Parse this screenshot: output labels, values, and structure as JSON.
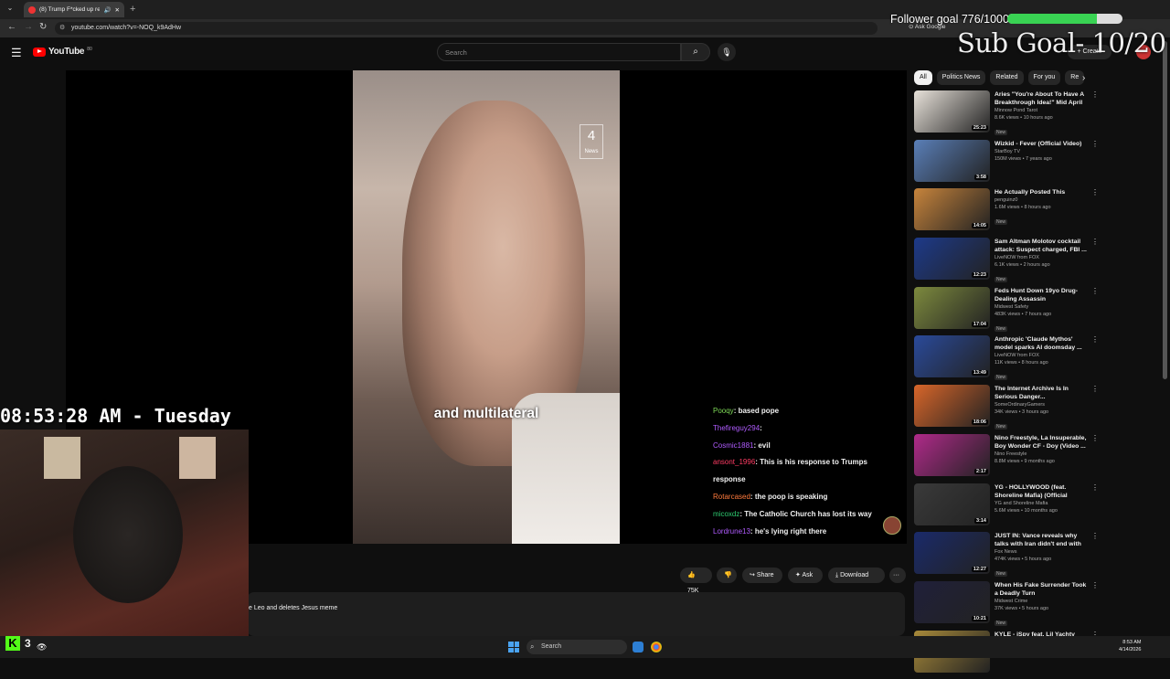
{
  "browser": {
    "tab_title": "(8) Trump F*cked up real ba...",
    "new_tab": "+",
    "url": "youtube.com/watch?v=-NOQ_k9AdHw",
    "ask_google": "Ask Google"
  },
  "yt": {
    "logo": "YouTube",
    "logo_sup": "80",
    "search_placeholder": "Search",
    "create": "+ Create",
    "chips": [
      "All",
      "Politics News",
      "Related",
      "For you",
      "Re"
    ]
  },
  "video": {
    "caption": "and multilateral",
    "channel_logo": "4",
    "channel_logo_sub": "News",
    "likes": "75K",
    "share": "Share",
    "ask": "Ask",
    "download": "Download",
    "more": "···",
    "description_snippet": "e Leo and deletes Jesus meme"
  },
  "chat": [
    {
      "user": "Pooqy",
      "color": "#7ed957",
      "msg": "based pope"
    },
    {
      "user": "Thefireguy294",
      "color": "#b05cff",
      "msg": ""
    },
    {
      "user": "Cosmic1881",
      "color": "#b05cff",
      "msg": "evil"
    },
    {
      "user": "ansont_1996",
      "color": "#ff3c64",
      "msg": "This is his response to Trumps response"
    },
    {
      "user": "Rotarcased",
      "color": "#ff7a3c",
      "msg": "the poop is speaking"
    },
    {
      "user": "micoxdz",
      "color": "#2ecc71",
      "msg": "The Catholic Church has lost its way"
    },
    {
      "user": "Lordrune13",
      "color": "#b05cff",
      "msg": "he's lying right there"
    }
  ],
  "recommendations": [
    {
      "title": "Aries \"You're About To Have A Breakthrough Idea!\" Mid April ...",
      "channel": "Minnow Pond Tarot",
      "views": "8.6K views • 10 hours ago",
      "badge": "New",
      "duration": "25:23",
      "thumb": "#e8e2da"
    },
    {
      "title": "Wizkid - Fever (Official Video)",
      "channel": "StarBoy TV",
      "views": "150M views • 7 years ago",
      "badge": "",
      "duration": "3:58",
      "thumb": "#5a7fb8"
    },
    {
      "title": "He Actually Posted This",
      "channel": "penguinz0",
      "views": "1.6M views • 8 hours ago",
      "badge": "New",
      "duration": "14:05",
      "thumb": "#c7843c"
    },
    {
      "title": "Sam Altman Molotov cocktail attack: Suspect charged, FBI ...",
      "channel": "LiveNOW from FOX",
      "views": "6.1K views • 2 hours ago",
      "badge": "New",
      "duration": "12:23",
      "thumb": "#1d3a8a"
    },
    {
      "title": "Feds Hunt Down 19yo Drug-Dealing Assassin",
      "channel": "Midwest Safety",
      "views": "483K views • 7 hours ago",
      "badge": "New",
      "duration": "17:04",
      "thumb": "#7d8a3e"
    },
    {
      "title": "Anthropic 'Claude Mythos' model sparks AI doomsday ...",
      "channel": "LiveNOW from FOX",
      "views": "11K views • 8 hours ago",
      "badge": "New",
      "duration": "13:49",
      "thumb": "#2a4a9a"
    },
    {
      "title": "The Internet Archive Is In Serious Danger...",
      "channel": "SomeOrdinaryGamers",
      "views": "34K views • 3 hours ago",
      "badge": "New",
      "duration": "18:06",
      "thumb": "#d8662a"
    },
    {
      "title": "Nino Freestyle, La Insuperable, Boy Wonder CF - Doy (Video ...",
      "channel": "Nino Freestyle",
      "views": "8.8M views • 9 months ago",
      "badge": "",
      "duration": "2:17",
      "thumb": "#b02a8a"
    },
    {
      "title": "YG - HOLLYWOOD (feat. Shoreline Mafia) (Official Musi...",
      "channel": "YG and Shoreline Mafia",
      "views": "5.6M views • 10 months ago",
      "badge": "",
      "duration": "3:14",
      "thumb": "#3a3a3a"
    },
    {
      "title": "JUST IN: Vance reveals why talks with Iran didn't end with ...",
      "channel": "Fox News",
      "views": "474K views • 5 hours ago",
      "badge": "New",
      "duration": "12:27",
      "thumb": "#1a2a6a"
    },
    {
      "title": "When His Fake Surrender Took a Deadly Turn",
      "channel": "Midwest Crime",
      "views": "37K views • 5 hours ago",
      "badge": "New",
      "duration": "10:21",
      "thumb": "#20203a"
    },
    {
      "title": "KYLE - iSpy feat. Lil Yachty (Official Music Video)",
      "channel": "",
      "views": "",
      "badge": "",
      "duration": "",
      "thumb": "#a88a3a"
    }
  ],
  "stream": {
    "follower_goal": "Follower goal 776/1000",
    "follower_progress": 0.776,
    "sub_goal": "Sub Goal- 10/20",
    "clock": "08:53:28 AM - Tuesday",
    "kick_viewers": "3"
  },
  "taskbar": {
    "search": "Search",
    "time": "8:53 AM",
    "date": "4/14/2026"
  }
}
